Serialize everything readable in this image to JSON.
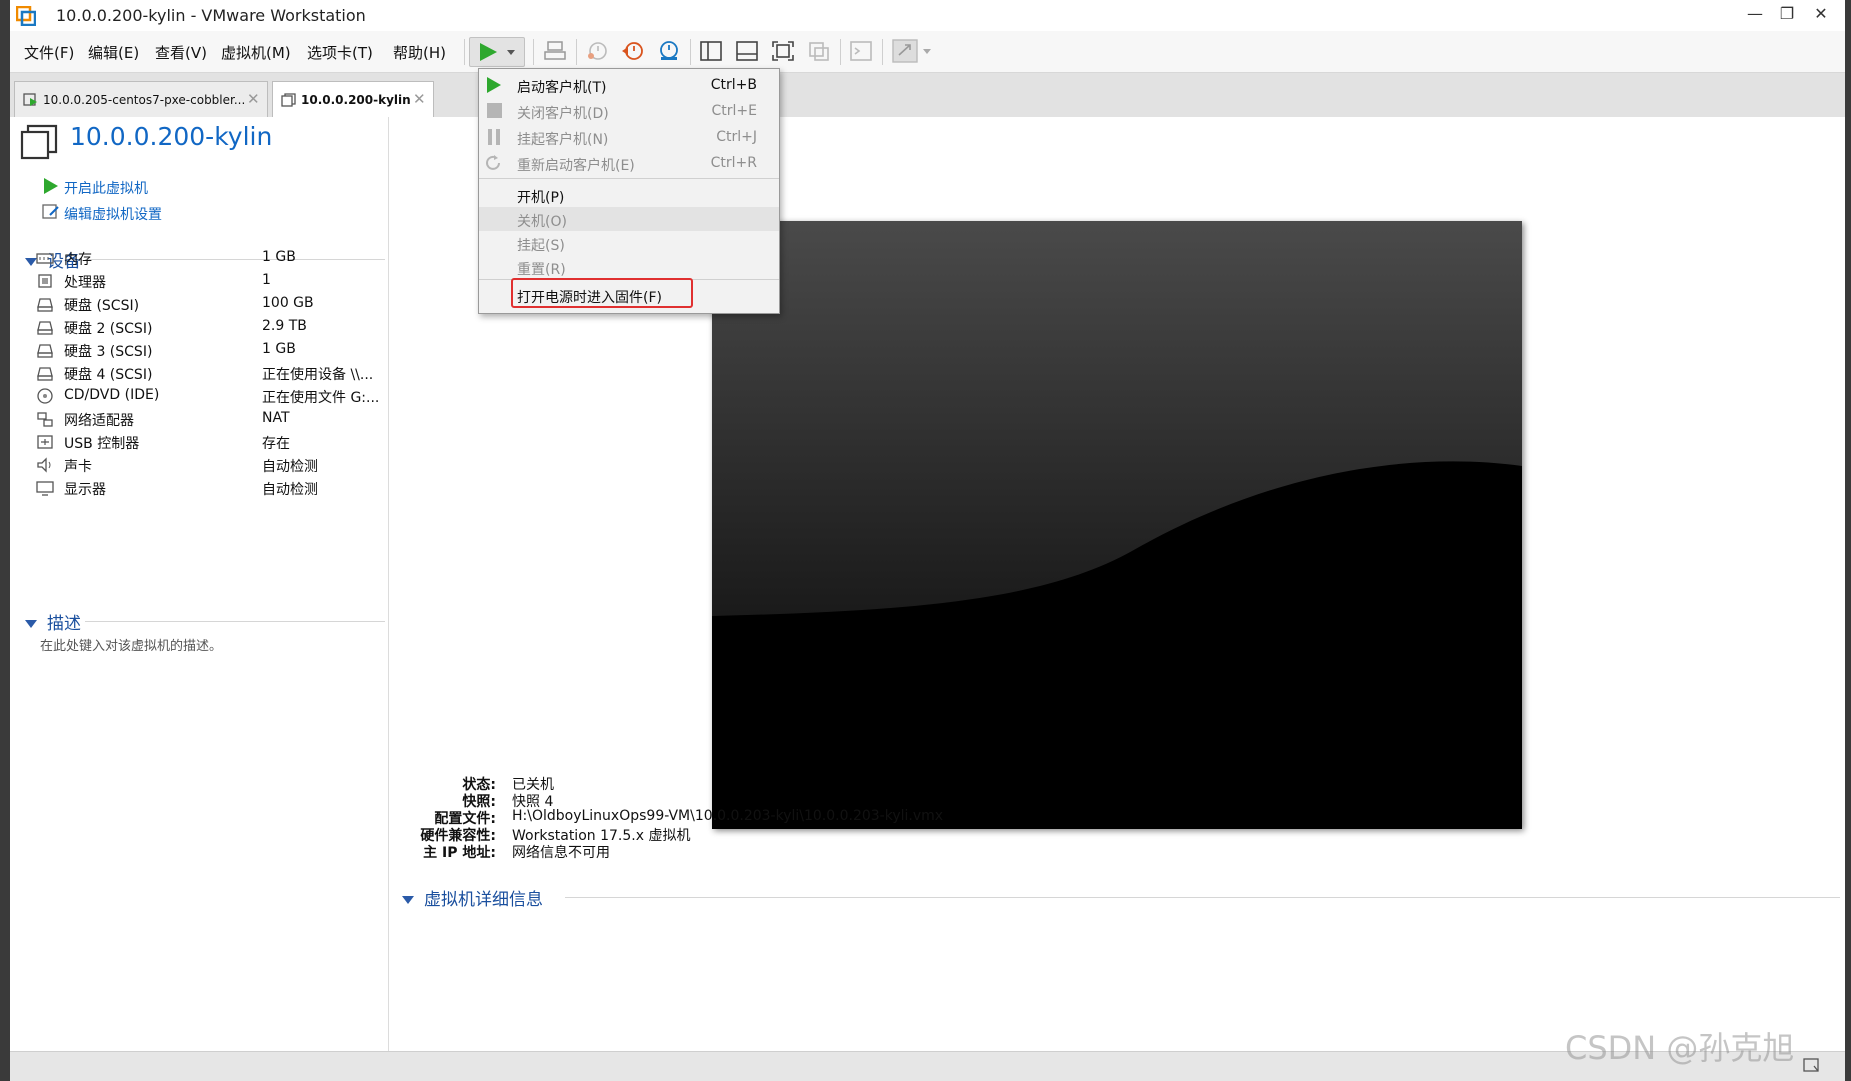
{
  "window": {
    "title": "10.0.0.200-kylin - VMware Workstation"
  },
  "menu": [
    "文件(F)",
    "编辑(E)",
    "查看(V)",
    "虚拟机(M)",
    "选项卡(T)",
    "帮助(H)"
  ],
  "tabs": [
    {
      "label": "10.0.0.205-centos7-pxe-cobbler...",
      "active": false
    },
    {
      "label": "10.0.0.200-kylin",
      "active": true
    }
  ],
  "vm": {
    "name": "10.0.0.200-kylin",
    "actions": [
      "开启此虚拟机",
      "编辑虚拟机设置"
    ]
  },
  "devices": {
    "title": "设备",
    "items": [
      {
        "name": "内存",
        "value": "1 GB",
        "icon": "memory-icon"
      },
      {
        "name": "处理器",
        "value": "1",
        "icon": "cpu-icon"
      },
      {
        "name": "硬盘 (SCSI)",
        "value": "100 GB",
        "icon": "disk-icon"
      },
      {
        "name": "硬盘 2 (SCSI)",
        "value": "2.9 TB",
        "icon": "disk-icon"
      },
      {
        "name": "硬盘 3 (SCSI)",
        "value": "1 GB",
        "icon": "disk-icon"
      },
      {
        "name": "硬盘 4 (SCSI)",
        "value": "正在使用设备 \\\\...",
        "icon": "disk-icon"
      },
      {
        "name": "CD/DVD (IDE)",
        "value": "正在使用文件 G:...",
        "icon": "cdrom-icon"
      },
      {
        "name": "网络适配器",
        "value": "NAT",
        "icon": "network-icon"
      },
      {
        "name": "USB 控制器",
        "value": "存在",
        "icon": "usb-icon"
      },
      {
        "name": "声卡",
        "value": "自动检测",
        "icon": "speaker-icon"
      },
      {
        "name": "显示器",
        "value": "自动检测",
        "icon": "monitor-icon"
      }
    ]
  },
  "description": {
    "title": "描述",
    "placeholder": "在此处键入对该虚拟机的描述。"
  },
  "details": {
    "title": "虚拟机详细信息",
    "rows": [
      {
        "key": "状态:",
        "value": "已关机"
      },
      {
        "key": "快照:",
        "value": "快照 4"
      },
      {
        "key": "配置文件:",
        "value": "H:\\OldboyLinuxOps99-VM\\10.0.0.203-kyli\\10.0.0.203-kyli.vmx"
      },
      {
        "key": "硬件兼容性:",
        "value": "Workstation 17.5.x 虚拟机"
      },
      {
        "key": "主 IP 地址:",
        "value": "网络信息不可用"
      }
    ]
  },
  "power_menu": {
    "items": [
      {
        "label": "启动客户机(T)",
        "shortcut": "Ctrl+B",
        "enabled": true,
        "icon": "play-icon"
      },
      {
        "label": "关闭客户机(D)",
        "shortcut": "Ctrl+E",
        "enabled": false,
        "icon": "stop-icon"
      },
      {
        "label": "挂起客户机(N)",
        "shortcut": "Ctrl+J",
        "enabled": false,
        "icon": "pause-icon"
      },
      {
        "label": "重新启动客户机(E)",
        "shortcut": "Ctrl+R",
        "enabled": false,
        "icon": "restart-icon"
      },
      {
        "label": "开机(P)",
        "shortcut": "",
        "enabled": true,
        "icon": ""
      },
      {
        "label": "关机(O)",
        "shortcut": "",
        "enabled": false,
        "icon": ""
      },
      {
        "label": "挂起(S)",
        "shortcut": "",
        "enabled": false,
        "icon": ""
      },
      {
        "label": "重置(R)",
        "shortcut": "",
        "enabled": false,
        "icon": ""
      },
      {
        "label": "打开电源时进入固件(F)",
        "shortcut": "",
        "enabled": true,
        "icon": ""
      }
    ]
  },
  "watermark": "CSDN @孙克旭",
  "colors": {
    "accent": "#1167c4",
    "play": "#2ea82e",
    "highlight": "#e03030"
  }
}
